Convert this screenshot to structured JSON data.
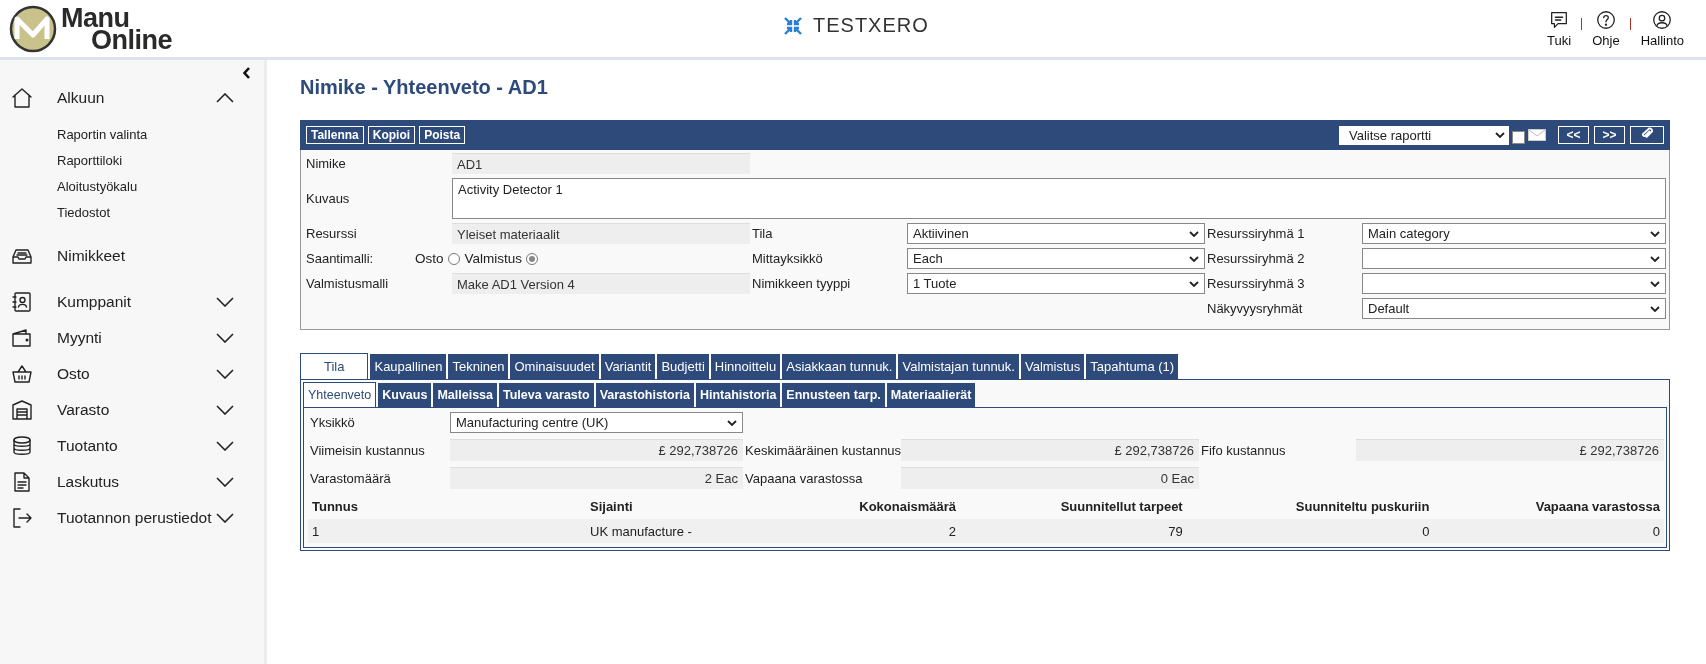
{
  "header": {
    "logo_top": "Manu",
    "logo_bottom": "Online",
    "company": "TESTXERO",
    "actions": [
      {
        "label": "Tuki"
      },
      {
        "label": "Ohje"
      },
      {
        "label": "Hallinto"
      }
    ]
  },
  "sidebar": {
    "items": [
      {
        "label": "Alkuun",
        "expanded": true,
        "children": [
          {
            "label": "Raportin valinta"
          },
          {
            "label": "Raporttiloki"
          },
          {
            "label": "Aloitustyökalu"
          },
          {
            "label": "Tiedostot"
          }
        ]
      },
      {
        "label": "Nimikkeet"
      },
      {
        "label": "Kumppanit",
        "expanded": false
      },
      {
        "label": "Myynti",
        "expanded": false
      },
      {
        "label": "Osto",
        "expanded": false
      },
      {
        "label": "Varasto",
        "expanded": false
      },
      {
        "label": "Tuotanto",
        "expanded": false
      },
      {
        "label": "Laskutus",
        "expanded": false
      },
      {
        "label": "Tuotannon perustiedot",
        "expanded": false
      }
    ]
  },
  "page": {
    "title": "Nimike - Yhteenveto - AD1"
  },
  "toolbar": {
    "buttons": [
      "Tallenna",
      "Kopioi",
      "Poista"
    ],
    "report_select": "Valitse raportti",
    "email_checked": false,
    "nav_buttons": [
      "<<",
      ">>"
    ]
  },
  "form": {
    "rows": [
      [
        {
          "kind": "readonly",
          "label": "Nimike",
          "value": "AD1"
        }
      ],
      [
        {
          "kind": "textarea",
          "label": "Kuvaus",
          "value": "Activity Detector 1"
        }
      ],
      [
        {
          "kind": "readonly",
          "label": "Resurssi",
          "value": "Yleiset materiaalit"
        },
        {
          "kind": "select",
          "label": "Tila",
          "value": "Aktiivinen"
        },
        {
          "kind": "select",
          "label": "Resurssiryhmä 1",
          "value": "Main category"
        }
      ],
      [
        {
          "kind": "radio",
          "label": "Saantimalli:",
          "options": [
            {
              "label": "Osto",
              "selected": false
            },
            {
              "label": "Valmistus",
              "selected": true
            }
          ]
        },
        {
          "kind": "select",
          "label": "Mittayksikkö",
          "value": "Each"
        },
        {
          "kind": "select",
          "label": "Resurssiryhmä 2"
        }
      ],
      [
        {
          "kind": "readonly",
          "label": "Valmistusmalli",
          "value": "Make AD1 Version 4"
        },
        {
          "kind": "select",
          "label": "Nimikkeen tyyppi",
          "value": "1 Tuote"
        },
        {
          "kind": "select",
          "label": "Resurssiryhmä 3"
        }
      ],
      [
        {
          "kind": "blank"
        },
        {
          "kind": "blank"
        },
        {
          "kind": "select",
          "label": "Näkyvyysryhmät",
          "value": "Default"
        }
      ]
    ]
  },
  "tabs": [
    {
      "label": "Tila",
      "selected": true
    },
    {
      "label": "Kaupallinen",
      "selected": false
    },
    {
      "label": "Tekninen",
      "selected": false
    },
    {
      "label": "Ominaisuudet",
      "selected": false
    },
    {
      "label": "Variantit",
      "selected": false
    },
    {
      "label": "Budjetti",
      "selected": false
    },
    {
      "label": "Hinnoittelu",
      "selected": false
    },
    {
      "label": "Asiakkaan tunnuk.",
      "selected": false
    },
    {
      "label": "Valmistajan tunnuk.",
      "selected": false
    },
    {
      "label": "Valmistus",
      "selected": false
    },
    {
      "label": "Tapahtuma (1)",
      "selected": false
    }
  ],
  "subtabs": [
    {
      "label": "Yhteenveto",
      "selected": true
    },
    {
      "label": "Kuvaus",
      "selected": false
    },
    {
      "label": "Malleissa",
      "selected": false
    },
    {
      "label": "Tuleva varasto",
      "selected": false
    },
    {
      "label": "Varastohistoria",
      "selected": false
    },
    {
      "label": "Hintahistoria",
      "selected": false
    },
    {
      "label": "Ennusteen tarp.",
      "selected": false
    },
    {
      "label": "Materiaalierät",
      "selected": false
    }
  ],
  "summary": {
    "rows": [
      [
        {
          "kind": "select",
          "label": "Yksikkö",
          "value": "Manufacturing centre (UK)"
        }
      ],
      [
        {
          "kind": "amount",
          "label": "Viimeisin kustannus",
          "value": "£ 292,738726"
        },
        {
          "kind": "amount",
          "label": "Keskimääräinen kustannus",
          "value": "£ 292,738726"
        },
        {
          "kind": "amount",
          "label": "Fifo kustannus",
          "value": "£ 292,738726"
        }
      ],
      [
        {
          "kind": "amount",
          "label": "Varastomäärä",
          "value": "2 Eac"
        },
        {
          "kind": "amount",
          "label": "Vapaana varastossa",
          "value": "0 Eac"
        }
      ]
    ],
    "table": {
      "columns": [
        "Tunnus",
        "Sijainti",
        "Kokonaismäärä",
        "Suunnitellut tarpeet",
        "Suunniteltu puskuriin",
        "Vapaana varastossa"
      ],
      "rows": [
        [
          "1",
          "UK manufacture -",
          "2",
          "79",
          "0",
          "0"
        ]
      ]
    }
  }
}
